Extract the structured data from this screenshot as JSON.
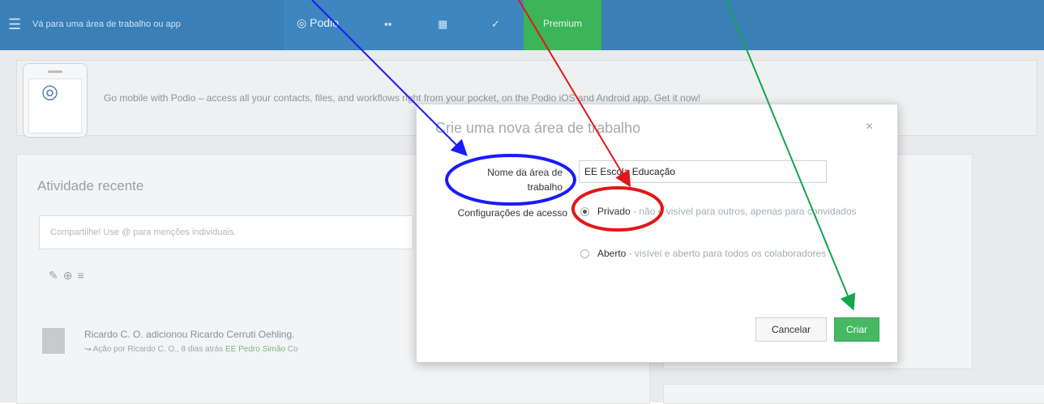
{
  "topbar": {
    "nav_placeholder": "Vá para uma área de trabalho ou app",
    "logo": "Podio",
    "premium_label": "Premium",
    "icons": [
      "menu-icon",
      "podio-logo-icon",
      "apps-grid-icon",
      "calendar-icon",
      "tasks-icon"
    ]
  },
  "banner": {
    "text": "Go mobile with Podio – access all your contacts, files, and workflows right from your pocket, on the Podio iOS and Android app. Get it now!"
  },
  "activity": {
    "title": "Atividade recente",
    "share_placeholder": "Compartilhe! Use @ para menções individuais.",
    "feed": {
      "line1": "Ricardo C. O. adicionou Ricardo Cerruti Oehling.",
      "line2_prefix": "Ação por Ricardo C. O., 8 dias atrás",
      "line2_link": "EE Pedro Simão",
      "line2_suffix": "Co"
    }
  },
  "modal": {
    "title": "Crie uma nova área de trabalho",
    "close_symbol": "×",
    "name_label": "Nome da área de trabalho",
    "name_value": "EE Escola Educação",
    "access_label": "Configurações de acesso",
    "options": [
      {
        "label": "Privado",
        "description": " - não é visível para outros, apenas para convidados",
        "checked": true
      },
      {
        "label": "Aberto",
        "description": " - visível e aberto para todos os colaboradores",
        "checked": false
      }
    ],
    "cancel_label": "Cancelar",
    "create_label": "Criar"
  },
  "colors": {
    "topbar": "#3a7fb6",
    "premium": "#3bb557",
    "create_button": "#46b963",
    "annotation_blue": "#1a1aff",
    "annotation_red": "#e01818",
    "annotation_green": "#14a64a"
  }
}
